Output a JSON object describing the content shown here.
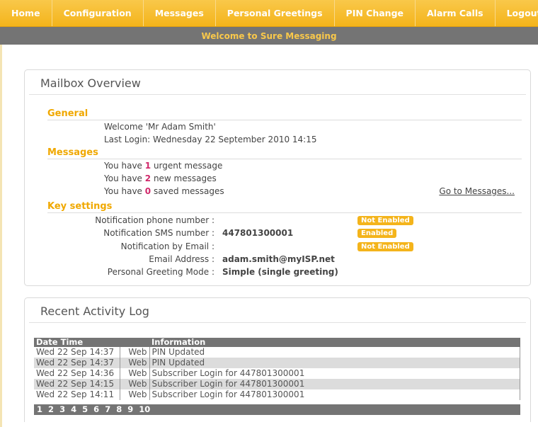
{
  "nav": {
    "items": [
      "Home",
      "Configuration",
      "Messages",
      "Personal Greetings",
      "PIN Change",
      "Alarm Calls",
      "Logout"
    ]
  },
  "welcome": "Welcome to Sure Messaging",
  "overview": {
    "title": "Mailbox Overview",
    "general": {
      "heading": "General",
      "welcome": "Welcome 'Mr Adam Smith'",
      "last_login": "Last Login: Wednesday 22 September 2010 14:15"
    },
    "messages": {
      "heading": "Messages",
      "urgent_prefix": "You have ",
      "urgent_count": "1",
      "urgent_suffix": " urgent message",
      "new_prefix": "You have ",
      "new_count": "2",
      "new_suffix": " new messages",
      "saved_prefix": "You have ",
      "saved_count": "0",
      "saved_suffix": " saved messages",
      "goto_link": "Go to Messages..."
    },
    "key_settings": {
      "heading": "Key settings",
      "rows": [
        {
          "label": "Notification phone number :",
          "value": "",
          "badge": "Not Enabled"
        },
        {
          "label": "Notification SMS number :",
          "value": "447801300001",
          "badge": "Enabled"
        },
        {
          "label": "Notification by Email :",
          "value": "",
          "badge": "Not Enabled"
        },
        {
          "label": "Email Address :",
          "value": "adam.smith@myISP.net",
          "badge": ""
        },
        {
          "label": "Personal Greeting Mode :",
          "value": "Simple (single greeting)",
          "badge": ""
        }
      ]
    }
  },
  "activity": {
    "title": "Recent Activity Log",
    "columns": [
      "Date Time",
      "",
      "Information"
    ],
    "rows": [
      {
        "time": "Wed 22 Sep 14:37",
        "source": "Web",
        "info": "PIN Updated"
      },
      {
        "time": "Wed 22 Sep 14:37",
        "source": "Web",
        "info": "PIN Updated"
      },
      {
        "time": "Wed 22 Sep 14:36",
        "source": "Web",
        "info": "Subscriber Login for 447801300001"
      },
      {
        "time": "Wed 22 Sep 14:15",
        "source": "Web",
        "info": "Subscriber Login for 447801300001"
      },
      {
        "time": "Wed 22 Sep 14:11",
        "source": "Web",
        "info": "Subscriber Login for 447801300001"
      }
    ],
    "pages": [
      "1",
      "2",
      "3",
      "4",
      "5",
      "6",
      "7",
      "8",
      "9",
      "10"
    ]
  },
  "colors": {
    "accent": "#f4b41b",
    "bar": "#747474",
    "count": "#d0286a"
  }
}
